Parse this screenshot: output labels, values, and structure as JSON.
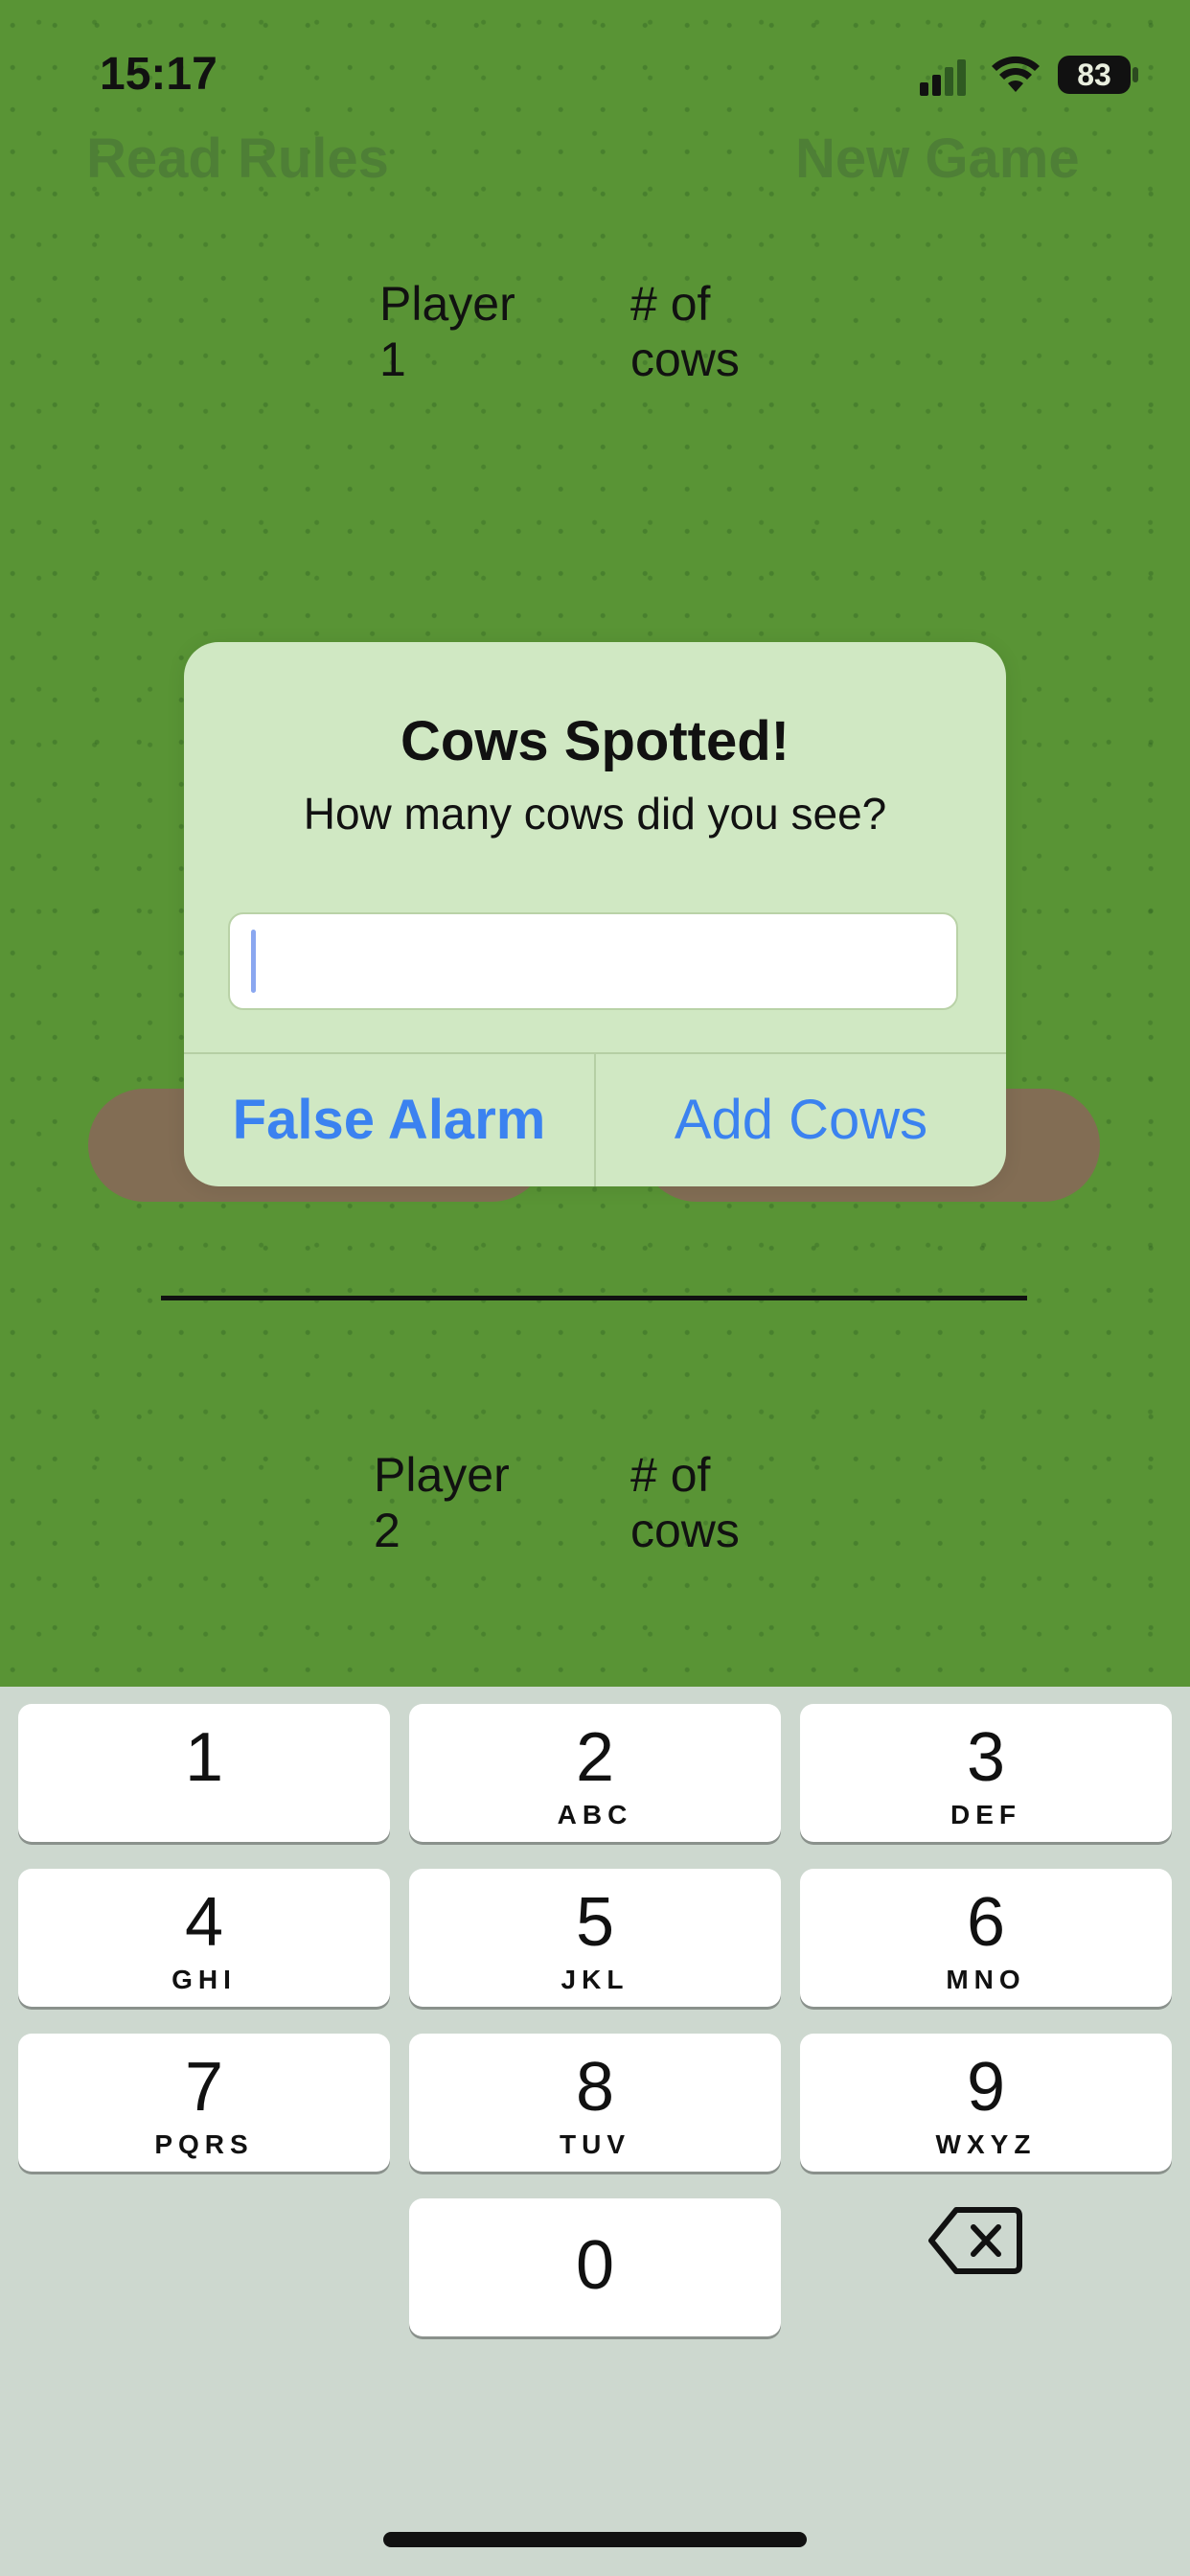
{
  "status_bar": {
    "time": "15:17",
    "battery": "83"
  },
  "header": {
    "read_rules": "Read Rules",
    "new_game": "New Game"
  },
  "players": [
    {
      "name": "Player 1",
      "cows_label": "# of cows"
    },
    {
      "name": "Player 2",
      "cows_label": "# of cows"
    }
  ],
  "alert": {
    "title": "Cows Spotted!",
    "message": "How many cows did you see?",
    "input_value": "",
    "cancel_label": "False Alarm",
    "confirm_label": "Add Cows",
    "accent_color": "#3b82f0"
  },
  "keypad": {
    "keys": [
      {
        "num": "1",
        "letters": ""
      },
      {
        "num": "2",
        "letters": "ABC"
      },
      {
        "num": "3",
        "letters": "DEF"
      },
      {
        "num": "4",
        "letters": "GHI"
      },
      {
        "num": "5",
        "letters": "JKL"
      },
      {
        "num": "6",
        "letters": "MNO"
      },
      {
        "num": "7",
        "letters": "PQRS"
      },
      {
        "num": "8",
        "letters": "TUV"
      },
      {
        "num": "9",
        "letters": "WXYZ"
      },
      {
        "num": "0",
        "letters": ""
      }
    ]
  },
  "colors": {
    "grass": "#599435",
    "button_brown": "#826d54",
    "dialog_bg": "#d0e8c3"
  }
}
